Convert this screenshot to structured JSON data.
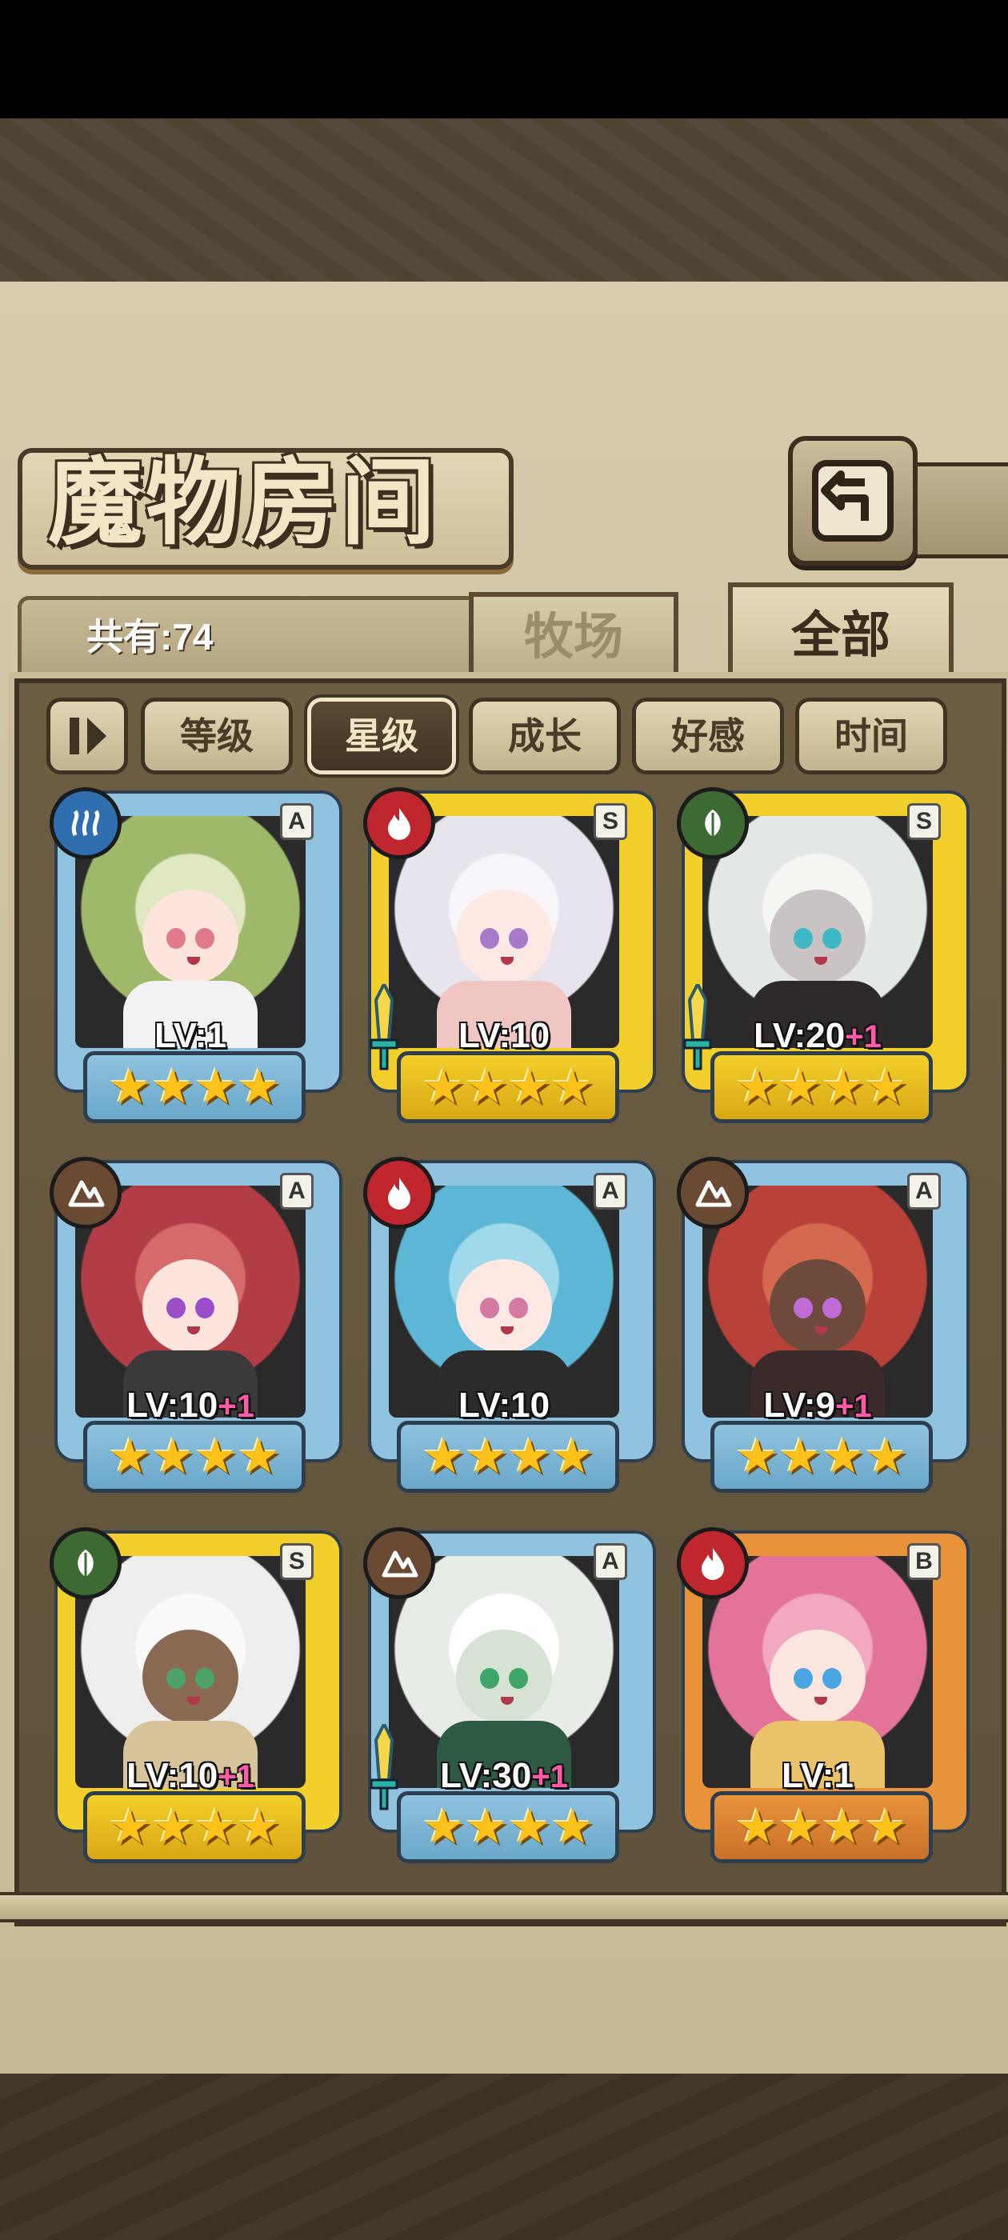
{
  "title": "魔物房间",
  "count_text": "共有:74",
  "tabs": [
    {
      "label": "牧场",
      "active": false
    },
    {
      "label": "全部",
      "active": true
    }
  ],
  "filters": [
    {
      "label": "等级",
      "active": false
    },
    {
      "label": "星级",
      "active": true
    },
    {
      "label": "成长",
      "active": false
    },
    {
      "label": "好感",
      "active": false
    },
    {
      "label": "时间",
      "active": false
    }
  ],
  "cards": [
    {
      "level": "LV:1",
      "bonus": "",
      "rank": "A",
      "element": "water",
      "stars": "★★★★",
      "weapon": false
    },
    {
      "level": "LV:10",
      "bonus": "",
      "rank": "S",
      "element": "fire",
      "stars": "★★★★",
      "weapon": true
    },
    {
      "level": "LV:20",
      "bonus": "+1",
      "rank": "S",
      "element": "leaf",
      "stars": "★★★★",
      "weapon": true
    },
    {
      "level": "LV:10",
      "bonus": "+1",
      "rank": "A",
      "element": "earth",
      "stars": "★★★★",
      "weapon": false
    },
    {
      "level": "LV:10",
      "bonus": "",
      "rank": "A",
      "element": "fire",
      "stars": "★★★★",
      "weapon": false
    },
    {
      "level": "LV:9",
      "bonus": "+1",
      "rank": "A",
      "element": "earth",
      "stars": "★★★★",
      "weapon": false
    },
    {
      "level": "LV:10",
      "bonus": "+1",
      "rank": "S",
      "element": "leaf",
      "stars": "★★★★",
      "weapon": false
    },
    {
      "level": "LV:30",
      "bonus": "+1",
      "rank": "A",
      "element": "earth",
      "stars": "★★★★",
      "weapon": true
    },
    {
      "level": "LV:1",
      "bonus": "",
      "rank": "B",
      "element": "fire",
      "stars": "★★★★",
      "weapon": false
    }
  ],
  "colors": {
    "frame_A": "#8fc3df",
    "frame_S": "#f2cf2a",
    "frame_B": "#e8923a",
    "elem_water": "#2f6fb0",
    "elem_fire": "#c0262d",
    "elem_leaf": "#3d6a33",
    "elem_earth": "#6b4a33"
  }
}
